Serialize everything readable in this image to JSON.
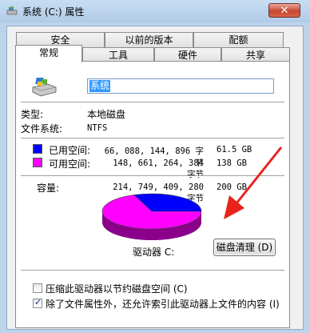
{
  "window": {
    "title": "系统 (C:) 属性",
    "close_symbol": "✕"
  },
  "tabs_row1": [
    {
      "label": "安全"
    },
    {
      "label": "以前的版本"
    },
    {
      "label": "配额"
    }
  ],
  "tabs_row2": [
    {
      "label": "常规",
      "active": true
    },
    {
      "label": "工具"
    },
    {
      "label": "硬件"
    },
    {
      "label": "共享"
    }
  ],
  "general": {
    "drive_icon": "drive-icon",
    "name_value": "系统",
    "type_label": "类型:",
    "type_value": "本地磁盘",
    "fs_label": "文件系统:",
    "fs_value": "NTFS",
    "used_label": "已用空间:",
    "used_bytes": "66, 088, 144, 896 字节",
    "used_size": "61.5 GB",
    "free_label": "可用空间:",
    "free_bytes": "148, 661, 264, 384 字节",
    "free_size": "138 GB",
    "capacity_label": "容量:",
    "capacity_bytes": "214, 749, 409, 280 字节",
    "capacity_size": "200 GB",
    "drive_label": "驱动器 C:",
    "cleanup_button": "磁盘清理 (D)",
    "compress_label": "压缩此驱动器以节约磁盘空间 (C)",
    "compress_checked": false,
    "index_label": "除了文件属性外，还允许索引此驱动器上文件的内容 (I)",
    "index_checked": true
  },
  "colors": {
    "used": "#0000ff",
    "free": "#ff00ff",
    "annotation_arrow": "#e8231c"
  },
  "chart_data": {
    "type": "pie",
    "categories": [
      "已用空间",
      "可用空间"
    ],
    "values": [
      61.5,
      138
    ]
  }
}
